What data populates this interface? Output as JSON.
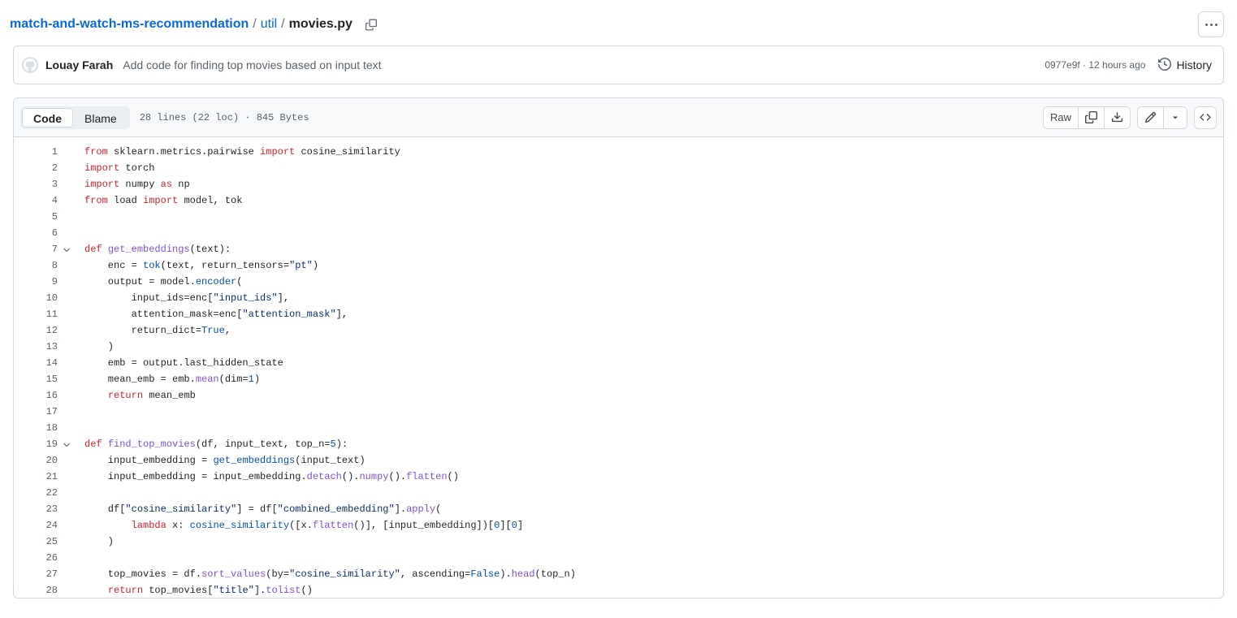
{
  "header": {
    "repo": "match-and-watch-ms-recommendation",
    "separator": "/",
    "directory": "util",
    "filename": "movies.py",
    "copy_path_icon": "copy-icon",
    "kebab_icon": "kebab-horizontal-icon"
  },
  "commit": {
    "avatar_icon": "github-mark-avatar",
    "author": "Louay Farah",
    "message": "Add code for finding top movies based on input text",
    "meta": "0977e9f · 12 hours ago",
    "history_label": "History",
    "history_icon": "history-clock-icon"
  },
  "toolbar": {
    "code_tab": "Code",
    "blame_tab": "Blame",
    "active_tab": "Code",
    "file_meta": "28 lines (22 loc) · 845 Bytes",
    "raw_label": "Raw",
    "copy_icon": "copy-raw-icon",
    "download_icon": "download-icon",
    "edit_icon": "pencil-edit-icon",
    "caret_icon": "triangle-down-icon",
    "symbols_icon": "code-symbols-icon"
  },
  "colors": {
    "link": "#0969da",
    "keyword": "#cf222e",
    "function": "#8250df",
    "string": "#0a3069",
    "constant": "#0550ae",
    "border": "#d1d9e0",
    "toolbar_bg": "#f6f8fa"
  },
  "code": {
    "language": "python",
    "total_lines": 28,
    "lines": [
      {
        "n": 1,
        "fold": false,
        "tokens": [
          {
            "t": "from",
            "c": "kw"
          },
          {
            "t": " sklearn.metrics.pairwise ",
            "c": ""
          },
          {
            "t": "import",
            "c": "kw"
          },
          {
            "t": " cosine_similarity",
            "c": ""
          }
        ]
      },
      {
        "n": 2,
        "fold": false,
        "tokens": [
          {
            "t": "import",
            "c": "kw"
          },
          {
            "t": " torch",
            "c": ""
          }
        ]
      },
      {
        "n": 3,
        "fold": false,
        "tokens": [
          {
            "t": "import",
            "c": "kw"
          },
          {
            "t": " numpy ",
            "c": ""
          },
          {
            "t": "as",
            "c": "kw"
          },
          {
            "t": " np",
            "c": ""
          }
        ]
      },
      {
        "n": 4,
        "fold": false,
        "tokens": [
          {
            "t": "from",
            "c": "kw"
          },
          {
            "t": " load ",
            "c": ""
          },
          {
            "t": "import",
            "c": "kw"
          },
          {
            "t": " model, tok",
            "c": ""
          }
        ]
      },
      {
        "n": 5,
        "fold": false,
        "tokens": []
      },
      {
        "n": 6,
        "fold": false,
        "tokens": []
      },
      {
        "n": 7,
        "fold": true,
        "tokens": [
          {
            "t": "def",
            "c": "kw"
          },
          {
            "t": " ",
            "c": ""
          },
          {
            "t": "get_embeddings",
            "c": "fn"
          },
          {
            "t": "(text):",
            "c": ""
          }
        ]
      },
      {
        "n": 8,
        "fold": false,
        "tokens": [
          {
            "t": "    enc = ",
            "c": ""
          },
          {
            "t": "tok",
            "c": "call"
          },
          {
            "t": "(text, return_tensors=",
            "c": ""
          },
          {
            "t": "\"pt\"",
            "c": "str"
          },
          {
            "t": ")",
            "c": ""
          }
        ]
      },
      {
        "n": 9,
        "fold": false,
        "tokens": [
          {
            "t": "    output = model.",
            "c": ""
          },
          {
            "t": "encoder",
            "c": "call"
          },
          {
            "t": "(",
            "c": ""
          }
        ]
      },
      {
        "n": 10,
        "fold": false,
        "tokens": [
          {
            "t": "        input_ids=enc[",
            "c": ""
          },
          {
            "t": "\"input_ids\"",
            "c": "str"
          },
          {
            "t": "],",
            "c": ""
          }
        ]
      },
      {
        "n": 11,
        "fold": false,
        "tokens": [
          {
            "t": "        attention_mask=enc[",
            "c": ""
          },
          {
            "t": "\"attention_mask\"",
            "c": "str"
          },
          {
            "t": "],",
            "c": ""
          }
        ]
      },
      {
        "n": 12,
        "fold": false,
        "tokens": [
          {
            "t": "        return_dict=",
            "c": ""
          },
          {
            "t": "True",
            "c": "cst"
          },
          {
            "t": ",",
            "c": ""
          }
        ]
      },
      {
        "n": 13,
        "fold": false,
        "tokens": [
          {
            "t": "    )",
            "c": ""
          }
        ]
      },
      {
        "n": 14,
        "fold": false,
        "tokens": [
          {
            "t": "    emb = output.last_hidden_state",
            "c": ""
          }
        ]
      },
      {
        "n": 15,
        "fold": false,
        "tokens": [
          {
            "t": "    mean_emb = emb.",
            "c": ""
          },
          {
            "t": "mean",
            "c": "mth"
          },
          {
            "t": "(dim=",
            "c": ""
          },
          {
            "t": "1",
            "c": "num"
          },
          {
            "t": ")",
            "c": ""
          }
        ]
      },
      {
        "n": 16,
        "fold": false,
        "tokens": [
          {
            "t": "    ",
            "c": ""
          },
          {
            "t": "return",
            "c": "kw"
          },
          {
            "t": " mean_emb",
            "c": ""
          }
        ]
      },
      {
        "n": 17,
        "fold": false,
        "tokens": []
      },
      {
        "n": 18,
        "fold": false,
        "tokens": []
      },
      {
        "n": 19,
        "fold": true,
        "tokens": [
          {
            "t": "def",
            "c": "kw"
          },
          {
            "t": " ",
            "c": ""
          },
          {
            "t": "find_top_movies",
            "c": "fn"
          },
          {
            "t": "(df, input_text, top_n=",
            "c": ""
          },
          {
            "t": "5",
            "c": "num"
          },
          {
            "t": "):",
            "c": ""
          }
        ]
      },
      {
        "n": 20,
        "fold": false,
        "tokens": [
          {
            "t": "    input_embedding = ",
            "c": ""
          },
          {
            "t": "get_embeddings",
            "c": "call"
          },
          {
            "t": "(input_text)",
            "c": ""
          }
        ]
      },
      {
        "n": 21,
        "fold": false,
        "tokens": [
          {
            "t": "    input_embedding = input_embedding.",
            "c": ""
          },
          {
            "t": "detach",
            "c": "mth"
          },
          {
            "t": "().",
            "c": ""
          },
          {
            "t": "numpy",
            "c": "mth"
          },
          {
            "t": "().",
            "c": ""
          },
          {
            "t": "flatten",
            "c": "mth"
          },
          {
            "t": "()",
            "c": ""
          }
        ]
      },
      {
        "n": 22,
        "fold": false,
        "tokens": []
      },
      {
        "n": 23,
        "fold": false,
        "tokens": [
          {
            "t": "    df[",
            "c": ""
          },
          {
            "t": "\"cosine_similarity\"",
            "c": "str"
          },
          {
            "t": "] = df[",
            "c": ""
          },
          {
            "t": "\"combined_embedding\"",
            "c": "str"
          },
          {
            "t": "].",
            "c": ""
          },
          {
            "t": "apply",
            "c": "mth"
          },
          {
            "t": "(",
            "c": ""
          }
        ]
      },
      {
        "n": 24,
        "fold": false,
        "tokens": [
          {
            "t": "        ",
            "c": ""
          },
          {
            "t": "lambda",
            "c": "kw"
          },
          {
            "t": " x: ",
            "c": ""
          },
          {
            "t": "cosine_similarity",
            "c": "call"
          },
          {
            "t": "([x.",
            "c": ""
          },
          {
            "t": "flatten",
            "c": "mth"
          },
          {
            "t": "()], [input_embedding])[",
            "c": ""
          },
          {
            "t": "0",
            "c": "num"
          },
          {
            "t": "][",
            "c": ""
          },
          {
            "t": "0",
            "c": "num"
          },
          {
            "t": "]",
            "c": ""
          }
        ]
      },
      {
        "n": 25,
        "fold": false,
        "tokens": [
          {
            "t": "    )",
            "c": ""
          }
        ]
      },
      {
        "n": 26,
        "fold": false,
        "tokens": []
      },
      {
        "n": 27,
        "fold": false,
        "tokens": [
          {
            "t": "    top_movies = df.",
            "c": ""
          },
          {
            "t": "sort_values",
            "c": "mth"
          },
          {
            "t": "(by=",
            "c": ""
          },
          {
            "t": "\"cosine_similarity\"",
            "c": "str"
          },
          {
            "t": ", ascending=",
            "c": ""
          },
          {
            "t": "False",
            "c": "cst"
          },
          {
            "t": ").",
            "c": ""
          },
          {
            "t": "head",
            "c": "mth"
          },
          {
            "t": "(top_n)",
            "c": ""
          }
        ]
      },
      {
        "n": 28,
        "fold": false,
        "tokens": [
          {
            "t": "    ",
            "c": ""
          },
          {
            "t": "return",
            "c": "kw"
          },
          {
            "t": " top_movies[",
            "c": ""
          },
          {
            "t": "\"title\"",
            "c": "str"
          },
          {
            "t": "].",
            "c": ""
          },
          {
            "t": "tolist",
            "c": "mth"
          },
          {
            "t": "()",
            "c": ""
          }
        ]
      }
    ]
  }
}
